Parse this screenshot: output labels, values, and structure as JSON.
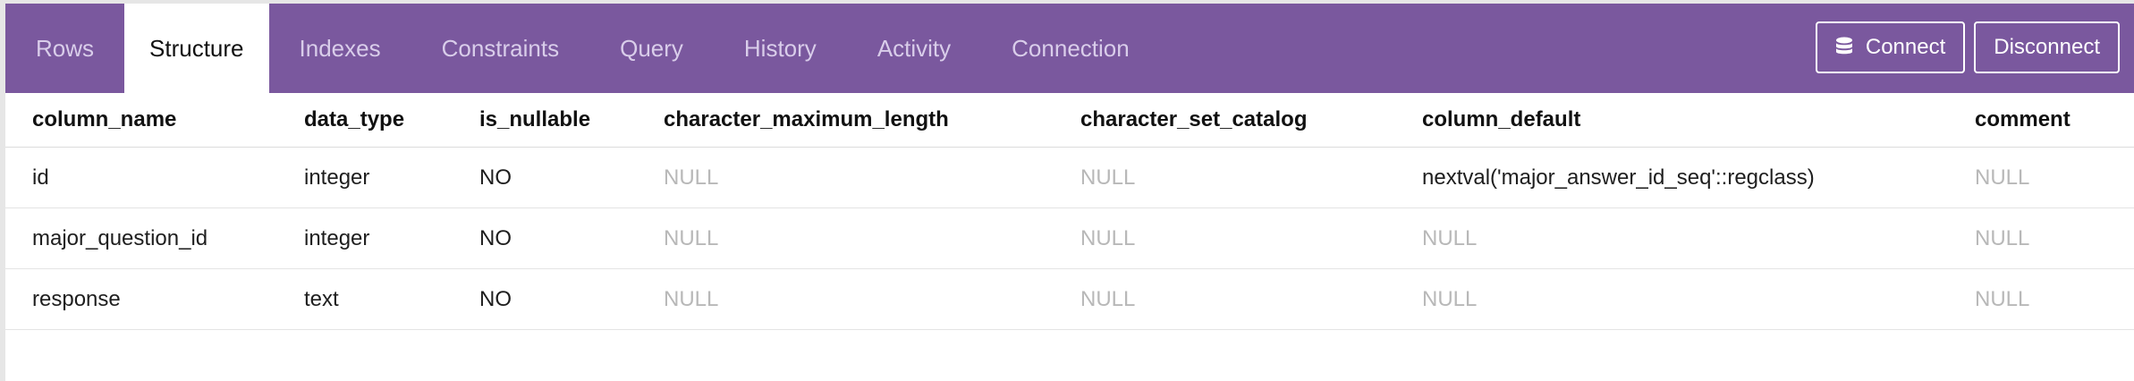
{
  "tabs": [
    {
      "label": "Rows"
    },
    {
      "label": "Structure"
    },
    {
      "label": "Indexes"
    },
    {
      "label": "Constraints"
    },
    {
      "label": "Query"
    },
    {
      "label": "History"
    },
    {
      "label": "Activity"
    },
    {
      "label": "Connection"
    }
  ],
  "active_tab": "Structure",
  "actions": {
    "connect_label": "Connect",
    "disconnect_label": "Disconnect"
  },
  "table": {
    "columns": [
      "column_name",
      "data_type",
      "is_nullable",
      "character_maximum_length",
      "character_set_catalog",
      "column_default",
      "comment"
    ],
    "rows": [
      [
        "id",
        "integer",
        "NO",
        "NULL",
        "NULL",
        "nextval('major_answer_id_seq'::regclass)",
        "NULL"
      ],
      [
        "major_question_id",
        "integer",
        "NO",
        "NULL",
        "NULL",
        "NULL",
        "NULL"
      ],
      [
        "response",
        "text",
        "NO",
        "NULL",
        "NULL",
        "NULL",
        "NULL"
      ]
    ]
  },
  "colors": {
    "topbar": "#7a589e",
    "tab_inactive_text": "#d9cdea",
    "null_text": "#b8b8b8"
  }
}
